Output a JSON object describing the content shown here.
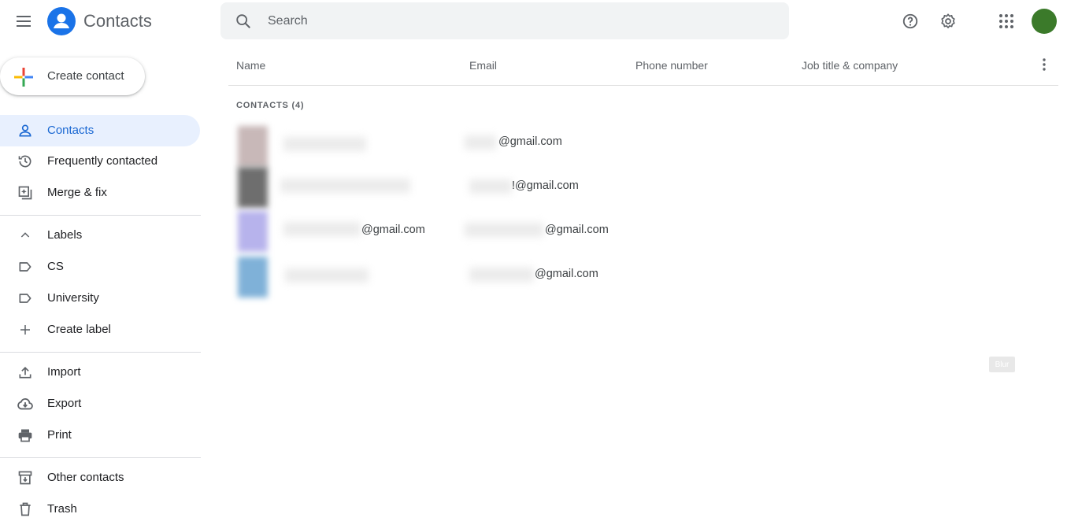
{
  "header": {
    "app_title": "Contacts",
    "search_placeholder": "Search"
  },
  "sidebar": {
    "create_label": "Create contact",
    "items": [
      {
        "label": "Contacts",
        "icon": "person-icon",
        "active": true
      },
      {
        "label": "Frequently contacted",
        "icon": "history-icon"
      },
      {
        "label": "Merge & fix",
        "icon": "merge-fix-icon"
      }
    ],
    "labels_header": "Labels",
    "labels": [
      {
        "label": "CS",
        "icon": "label-icon"
      },
      {
        "label": "University",
        "icon": "label-icon"
      }
    ],
    "create_label_label": "Create label",
    "tools": [
      {
        "label": "Import",
        "icon": "upload-icon"
      },
      {
        "label": "Export",
        "icon": "cloud-download-icon"
      },
      {
        "label": "Print",
        "icon": "print-icon"
      }
    ],
    "bottom": [
      {
        "label": "Other contacts",
        "icon": "archive-icon"
      },
      {
        "label": "Trash",
        "icon": "trash-icon"
      }
    ]
  },
  "table": {
    "columns": [
      "Name",
      "Email",
      "Phone number",
      "Job title & company"
    ],
    "section_label": "CONTACTS (4)",
    "rows": [
      {
        "name": "",
        "email": "@gmail.com",
        "photo_color": "#c8b8b8"
      },
      {
        "name": "",
        "email": "!@gmail.com",
        "photo_color": "#6e6e6e"
      },
      {
        "name": "@gmail.com",
        "email": "@gmail.com",
        "photo_color": "#b7b3ec"
      },
      {
        "name": "",
        "email": "@gmail.com",
        "photo_color": "#7fb1d8"
      }
    ]
  },
  "blur_badge": "Blur",
  "colors": {
    "accent": "#1a73e8",
    "active_bg": "#e8f0fe",
    "avatar": "#3b7a2a"
  }
}
